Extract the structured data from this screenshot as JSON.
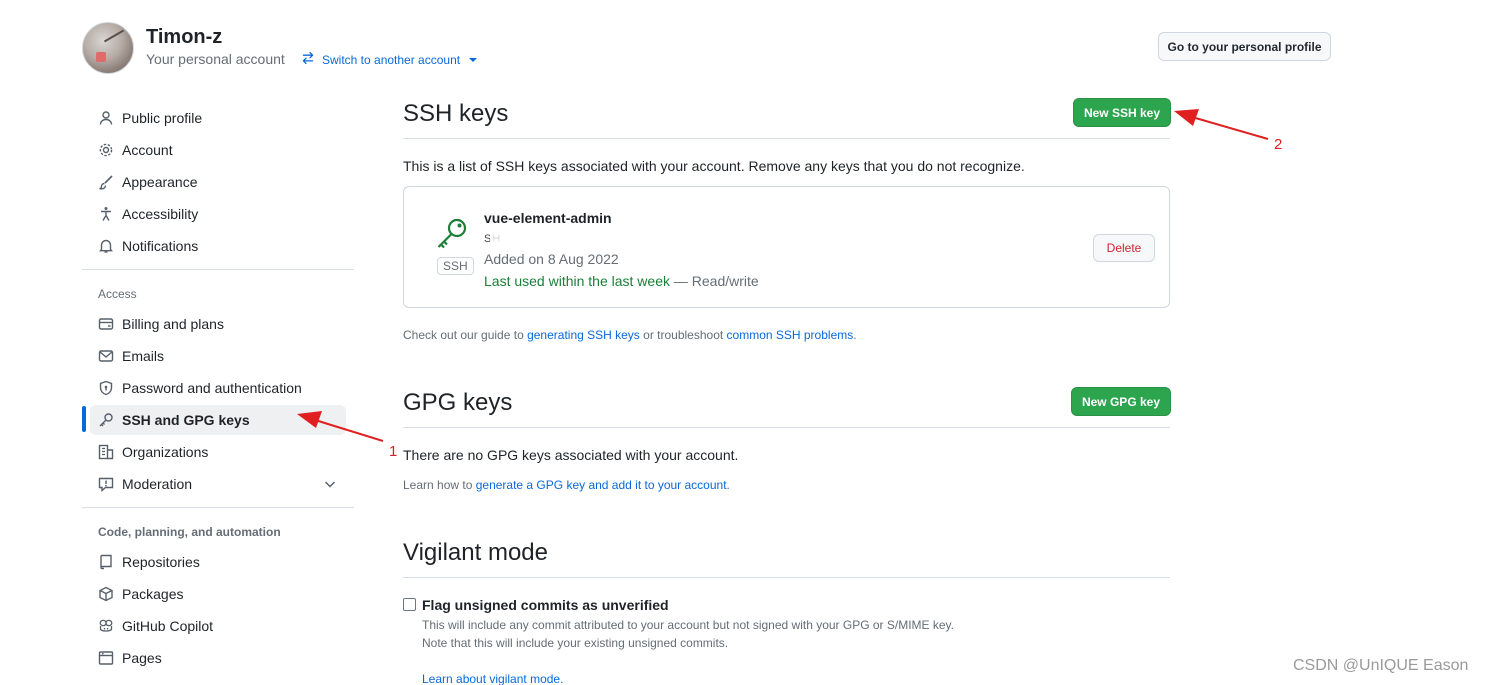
{
  "header": {
    "username": "Timon-z",
    "subtitle": "Your personal account",
    "switch_account": "Switch to another account",
    "profile_button": "Go to your personal profile"
  },
  "sidebar": {
    "items_top": [
      {
        "label": "Public profile",
        "icon": "person-icon"
      },
      {
        "label": "Account",
        "icon": "gear-icon"
      },
      {
        "label": "Appearance",
        "icon": "paintbrush-icon"
      },
      {
        "label": "Accessibility",
        "icon": "accessibility-icon"
      },
      {
        "label": "Notifications",
        "icon": "bell-icon"
      }
    ],
    "access_heading": "Access",
    "items_access": [
      {
        "label": "Billing and plans",
        "icon": "credit-card-icon"
      },
      {
        "label": "Emails",
        "icon": "mail-icon"
      },
      {
        "label": "Password and authentication",
        "icon": "shield-lock-icon"
      },
      {
        "label": "SSH and GPG keys",
        "icon": "key-icon"
      },
      {
        "label": "Organizations",
        "icon": "organization-icon"
      },
      {
        "label": "Moderation",
        "icon": "report-icon"
      }
    ],
    "code_heading": "Code, planning, and automation",
    "items_code": [
      {
        "label": "Repositories",
        "icon": "repo-icon"
      },
      {
        "label": "Packages",
        "icon": "package-icon"
      },
      {
        "label": "GitHub Copilot",
        "icon": "copilot-icon"
      },
      {
        "label": "Pages",
        "icon": "browser-icon"
      }
    ],
    "active_item": "SSH and GPG keys"
  },
  "ssh": {
    "title": "SSH keys",
    "new_button": "New SSH key",
    "description": "This is a list of SSH keys associated with your account. Remove any keys that you do not recognize.",
    "key": {
      "title": "vue-element-admin",
      "fingerprint_prefix": "SH",
      "badge": "SSH",
      "added": "Added on 8 Aug 2022",
      "last_used": "Last used within the last week",
      "access": " — Read/write",
      "delete_button": "Delete"
    },
    "guide_prefix": "Check out our guide to ",
    "guide_link1": "generating SSH keys",
    "guide_middle": " or troubleshoot ",
    "guide_link2": "common SSH problems",
    "guide_suffix": "."
  },
  "gpg": {
    "title": "GPG keys",
    "new_button": "New GPG key",
    "empty_text": "There are no GPG keys associated with your account.",
    "learn_prefix": "Learn how to ",
    "learn_link": "generate a GPG key and add it to your account",
    "learn_suffix": "."
  },
  "vigilant": {
    "title": "Vigilant mode",
    "checkbox_label": "Flag unsigned commits as unverified",
    "checkbox_checked": false,
    "desc1": "This will include any commit attributed to your account but not signed with your GPG or S/MIME key.",
    "desc2": "Note that this will include your existing unsigned commits.",
    "learn_link": "Learn about vigilant mode."
  },
  "annotations": {
    "marker_1": "1",
    "marker_2": "2",
    "arrow_color": "#e02020"
  },
  "watermark": "CSDN @UnIQUE Eason",
  "colors": {
    "primary_green": "#2da44e",
    "link_blue": "#0969da",
    "active_bar": "#0969da",
    "danger_red": "#cf222e",
    "success_green": "#1a7f37"
  }
}
